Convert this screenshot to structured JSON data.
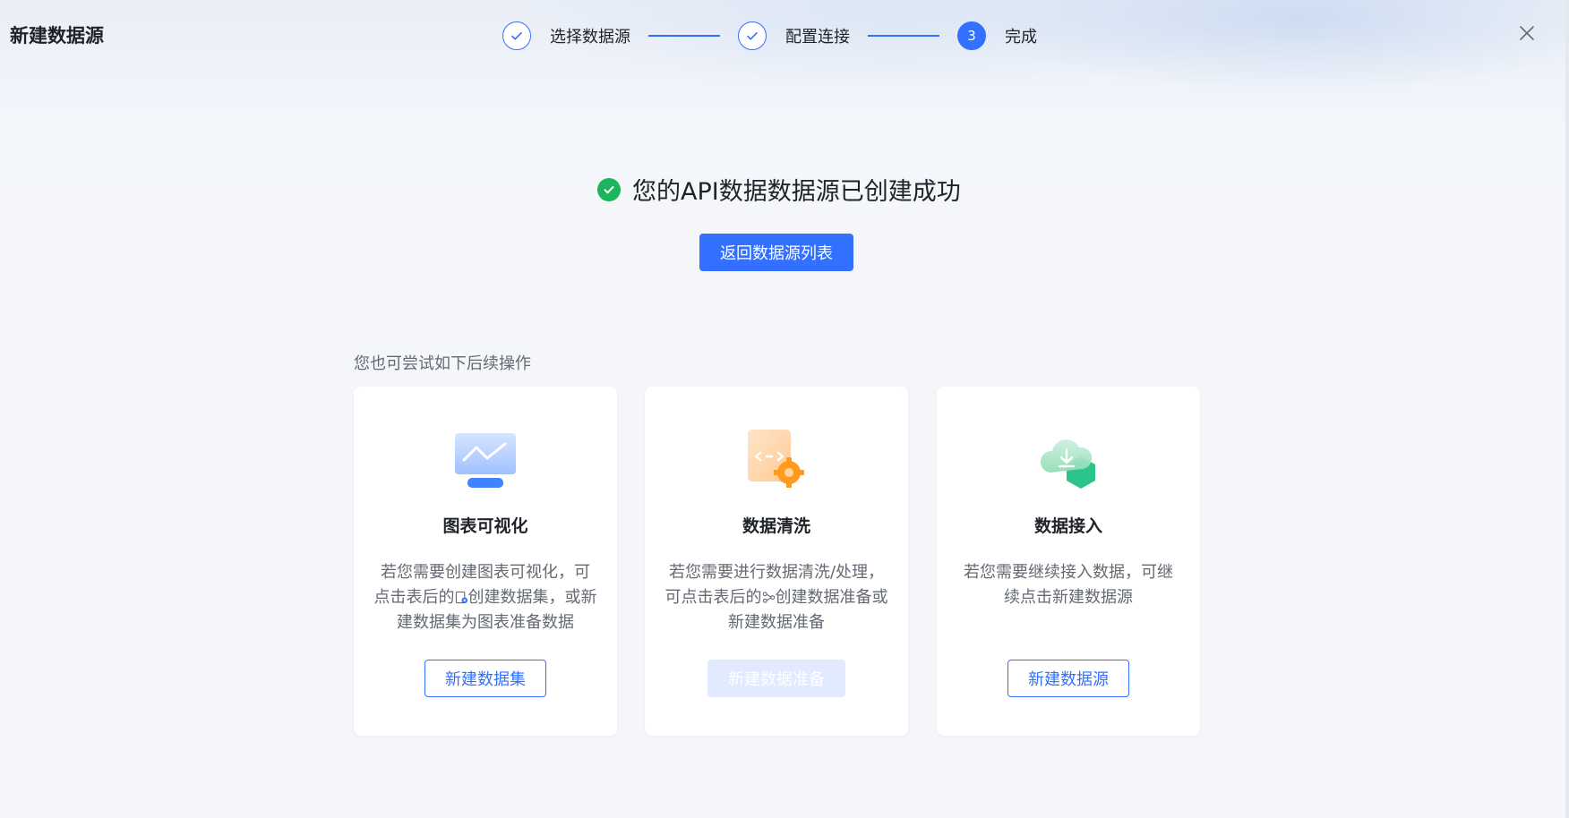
{
  "header": {
    "title": "新建数据源",
    "close_icon": "close-icon"
  },
  "steps": [
    {
      "label": "选择数据源",
      "state": "done"
    },
    {
      "label": "配置连接",
      "state": "done"
    },
    {
      "label": "完成",
      "state": "active",
      "number": "3"
    }
  ],
  "result": {
    "message": "您的API数据数据源已创建成功",
    "icon": "check-circle-icon",
    "back_button": "返回数据源列表"
  },
  "followup": {
    "hint": "您也可尝试如下后续操作",
    "cards": [
      {
        "title": "图表可视化",
        "desc_before": "若您需要创建图表可视化，可点击表后的",
        "desc_after": "创建数据集，或新建数据集为图表准备数据",
        "inline_icon": "dataset-icon",
        "button": "新建数据集",
        "button_state": "enabled",
        "icon": "chart-monitor-icon"
      },
      {
        "title": "数据清洗",
        "desc_before": "若您需要进行数据清洗/处理，可点击表后的",
        "desc_after": "创建数据准备或新建数据准备",
        "inline_icon": "flow-icon",
        "button": "新建数据准备",
        "button_state": "disabled",
        "icon": "code-gear-icon"
      },
      {
        "title": "数据接入",
        "desc_before": "若您需要继续接入数据，可继续点击新建数据源",
        "desc_after": "",
        "inline_icon": "",
        "button": "新建数据源",
        "button_state": "enabled",
        "icon": "cloud-download-icon"
      }
    ]
  },
  "colors": {
    "primary": "#3370ff",
    "success": "#1bb55c",
    "text": "#1f2329",
    "muted": "#646a73"
  }
}
